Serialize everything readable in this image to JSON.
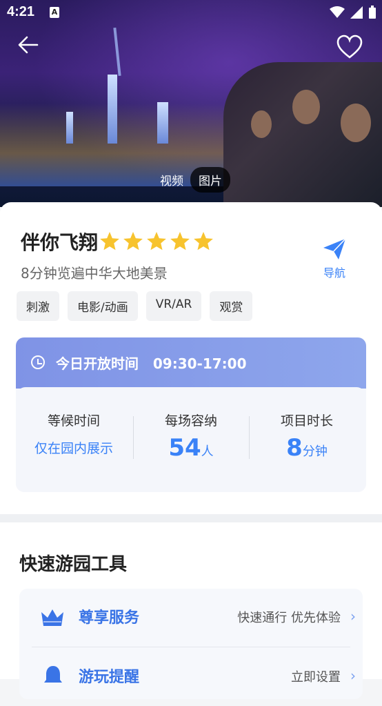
{
  "status_bar": {
    "time": "4:21",
    "notification_icon": "A"
  },
  "hero": {
    "media_toggle": [
      "视频",
      "图片"
    ],
    "selected": "图片"
  },
  "attraction": {
    "name": "伴你飞翔",
    "rating_stars": 5,
    "description": "8分钟览遍中华大地美景",
    "nav_label": "导航",
    "tags": [
      "刺激",
      "电影/动画",
      "VR/AR",
      "观赏"
    ]
  },
  "hours": {
    "label": "今日开放时间",
    "value": "09:30-17:00",
    "stats": [
      {
        "label": "等候时间",
        "value": "仅在园内展示"
      },
      {
        "label": "每场容纳",
        "number": "54",
        "unit": "人"
      },
      {
        "label": "项目时长",
        "number": "8",
        "unit": "分钟"
      }
    ]
  },
  "tools": {
    "title": "快速游园工具",
    "items": [
      {
        "name": "尊享服务",
        "desc": "快速通行 优先体验",
        "icon": "crown-icon"
      },
      {
        "name": "游玩提醒",
        "desc": "立即设置",
        "icon": "bell-icon"
      }
    ]
  },
  "colors": {
    "accent": "#3a82f7",
    "hours_header": "#8a9fe9"
  }
}
